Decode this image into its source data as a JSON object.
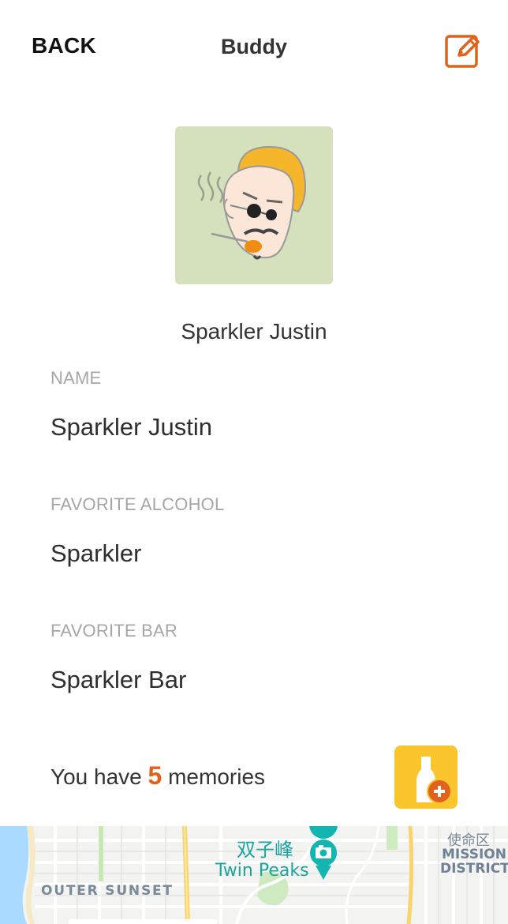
{
  "nav": {
    "back_label": "BACK",
    "title": "Buddy",
    "edit_icon": "edit-pencil-icon",
    "accent_color": "#e0621c"
  },
  "profile": {
    "avatar_icon": "buddy-avatar-illustration",
    "display_name": "Sparkler Justin"
  },
  "fields": [
    {
      "label": "NAME",
      "value": "Sparkler Justin"
    },
    {
      "label": "FAVORITE ALCOHOL",
      "value": "Sparkler"
    },
    {
      "label": "FAVORITE BAR",
      "value": "Sparkler Bar"
    }
  ],
  "memories": {
    "prefix": "You have",
    "count": "5",
    "suffix": "memories",
    "add_icon": "add-memory-bottle-icon",
    "button_color": "#fbc52e"
  },
  "map": {
    "poi_name_cn": "双子峰",
    "poi_name_en": "Twin Peaks",
    "poi_icon": "camera-pin-icon",
    "area_outer_sunset": "OUTER SUNSET",
    "district_cn": "使命区",
    "district_line1": "MISSION",
    "district_line2": "DISTRICT"
  }
}
